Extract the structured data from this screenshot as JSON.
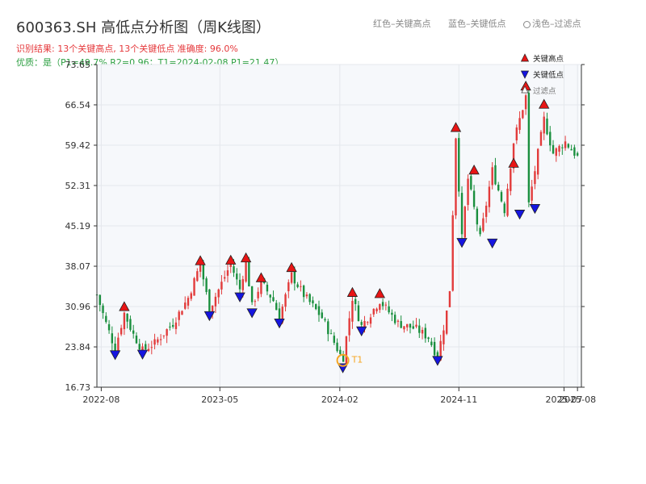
{
  "header": {
    "title": "600363.SH 高低点分析图（周K线图）",
    "result_line": "识别结果: 13个关键高点, 13个关键低点  准确度: 96.0%",
    "quality_line": "优质：是（P1=49.7%  R2=0.96；T1=2024-02-08 P1=21.47）"
  },
  "top_legend": {
    "red_label": "红色–关键高点",
    "blue_label": "蓝色–关键低点",
    "light_label": "浅色–过滤点"
  },
  "colors": {
    "up": "#e23b3b",
    "down": "#1a8f3e",
    "high_marker": "#e81515",
    "low_marker": "#1515e0",
    "t1": "#f5a623",
    "grid": "#e4e7ec",
    "plot_bg": "#f6f8fb"
  },
  "chart_data": {
    "type": "candlestick",
    "title": "600363.SH 高低点分析图（周K线图）",
    "y_ticks": [
      "16.73",
      "23.84",
      "30.96",
      "38.07",
      "45.19",
      "52.31",
      "59.42",
      "66.54",
      "73.65"
    ],
    "ylim": [
      16.73,
      73.65
    ],
    "x_ticks": [
      "2022-08",
      "2023-05",
      "2024-02",
      "2024-11",
      "2025-07",
      "2025-08"
    ],
    "x_tick_dates": [
      "2022-08-01",
      "2023-05-01",
      "2024-02-01",
      "2024-11-01",
      "2025-07-01",
      "2025-08-01"
    ],
    "x_start": "2022-07-22",
    "x_end": "2025-08-10",
    "legend": [
      "关键高点",
      "关键低点",
      "过滤点"
    ],
    "annotations": [
      {
        "label": "T1",
        "date": "2024-02-08",
        "value": 21.47
      }
    ],
    "close_path": [
      [
        "2022-07-22",
        33.0
      ],
      [
        "2022-08-12",
        28.0
      ],
      [
        "2022-09-02",
        23.5
      ],
      [
        "2022-09-23",
        29.8
      ],
      [
        "2022-10-14",
        26.0
      ],
      [
        "2022-11-04",
        23.2
      ],
      [
        "2022-12-02",
        24.5
      ],
      [
        "2023-01-13",
        28.0
      ],
      [
        "2023-02-17",
        32.5
      ],
      [
        "2023-03-17",
        38.5
      ],
      [
        "2023-04-07",
        30.5
      ],
      [
        "2023-05-26",
        38.5
      ],
      [
        "2023-06-16",
        34.0
      ],
      [
        "2023-06-30",
        39.0
      ],
      [
        "2023-07-14",
        31.0
      ],
      [
        "2023-08-04",
        35.3
      ],
      [
        "2023-09-01",
        32.0
      ],
      [
        "2023-09-15",
        29.0
      ],
      [
        "2023-10-13",
        36.5
      ],
      [
        "2023-11-10",
        33.0
      ],
      [
        "2023-12-22",
        29.0
      ],
      [
        "2024-02-08",
        21.5
      ],
      [
        "2024-03-01",
        32.5
      ],
      [
        "2024-03-22",
        27.5
      ],
      [
        "2024-05-03",
        32.0
      ],
      [
        "2024-06-14",
        28.0
      ],
      [
        "2024-07-26",
        27.0
      ],
      [
        "2024-08-23",
        25.5
      ],
      [
        "2024-09-13",
        22.0
      ],
      [
        "2024-10-04",
        30.0
      ],
      [
        "2024-10-11",
        34.0
      ],
      [
        "2024-10-25",
        61.0
      ],
      [
        "2024-11-08",
        43.0
      ],
      [
        "2024-11-22",
        53.5
      ],
      [
        "2024-12-20",
        43.0
      ],
      [
        "2025-01-17",
        55.0
      ],
      [
        "2025-02-14",
        48.0
      ],
      [
        "2025-03-07",
        60.0
      ],
      [
        "2025-04-04",
        68.0
      ],
      [
        "2025-04-11",
        49.0
      ],
      [
        "2025-05-16",
        64.0
      ],
      [
        "2025-06-06",
        58.0
      ],
      [
        "2025-07-04",
        60.0
      ],
      [
        "2025-08-10",
        56.5
      ]
    ],
    "key_highs": [
      {
        "date": "2022-09-23",
        "value": 29.8
      },
      {
        "date": "2023-03-17",
        "value": 37.9
      },
      {
        "date": "2023-05-26",
        "value": 38.0
      },
      {
        "date": "2023-06-30",
        "value": 38.4
      },
      {
        "date": "2023-08-04",
        "value": 34.9
      },
      {
        "date": "2023-10-13",
        "value": 36.7
      },
      {
        "date": "2024-03-01",
        "value": 32.3
      },
      {
        "date": "2024-05-03",
        "value": 32.1
      },
      {
        "date": "2024-10-25",
        "value": 61.4
      },
      {
        "date": "2024-12-06",
        "value": 53.9
      },
      {
        "date": "2025-03-07",
        "value": 55.1
      },
      {
        "date": "2025-04-04",
        "value": 68.7
      },
      {
        "date": "2025-05-16",
        "value": 65.5
      }
    ],
    "key_lows": [
      {
        "date": "2022-09-02",
        "value": 23.6
      },
      {
        "date": "2022-11-04",
        "value": 23.7
      },
      {
        "date": "2023-04-07",
        "value": 30.5
      },
      {
        "date": "2023-06-16",
        "value": 33.8
      },
      {
        "date": "2023-07-14",
        "value": 31.0
      },
      {
        "date": "2023-09-15",
        "value": 29.2
      },
      {
        "date": "2024-02-08",
        "value": 21.3
      },
      {
        "date": "2024-03-22",
        "value": 27.8
      },
      {
        "date": "2024-09-13",
        "value": 22.6
      },
      {
        "date": "2024-11-08",
        "value": 43.4
      },
      {
        "date": "2025-01-17",
        "value": 43.3
      },
      {
        "date": "2025-03-21",
        "value": 48.4
      },
      {
        "date": "2025-04-25",
        "value": 49.4
      }
    ]
  }
}
